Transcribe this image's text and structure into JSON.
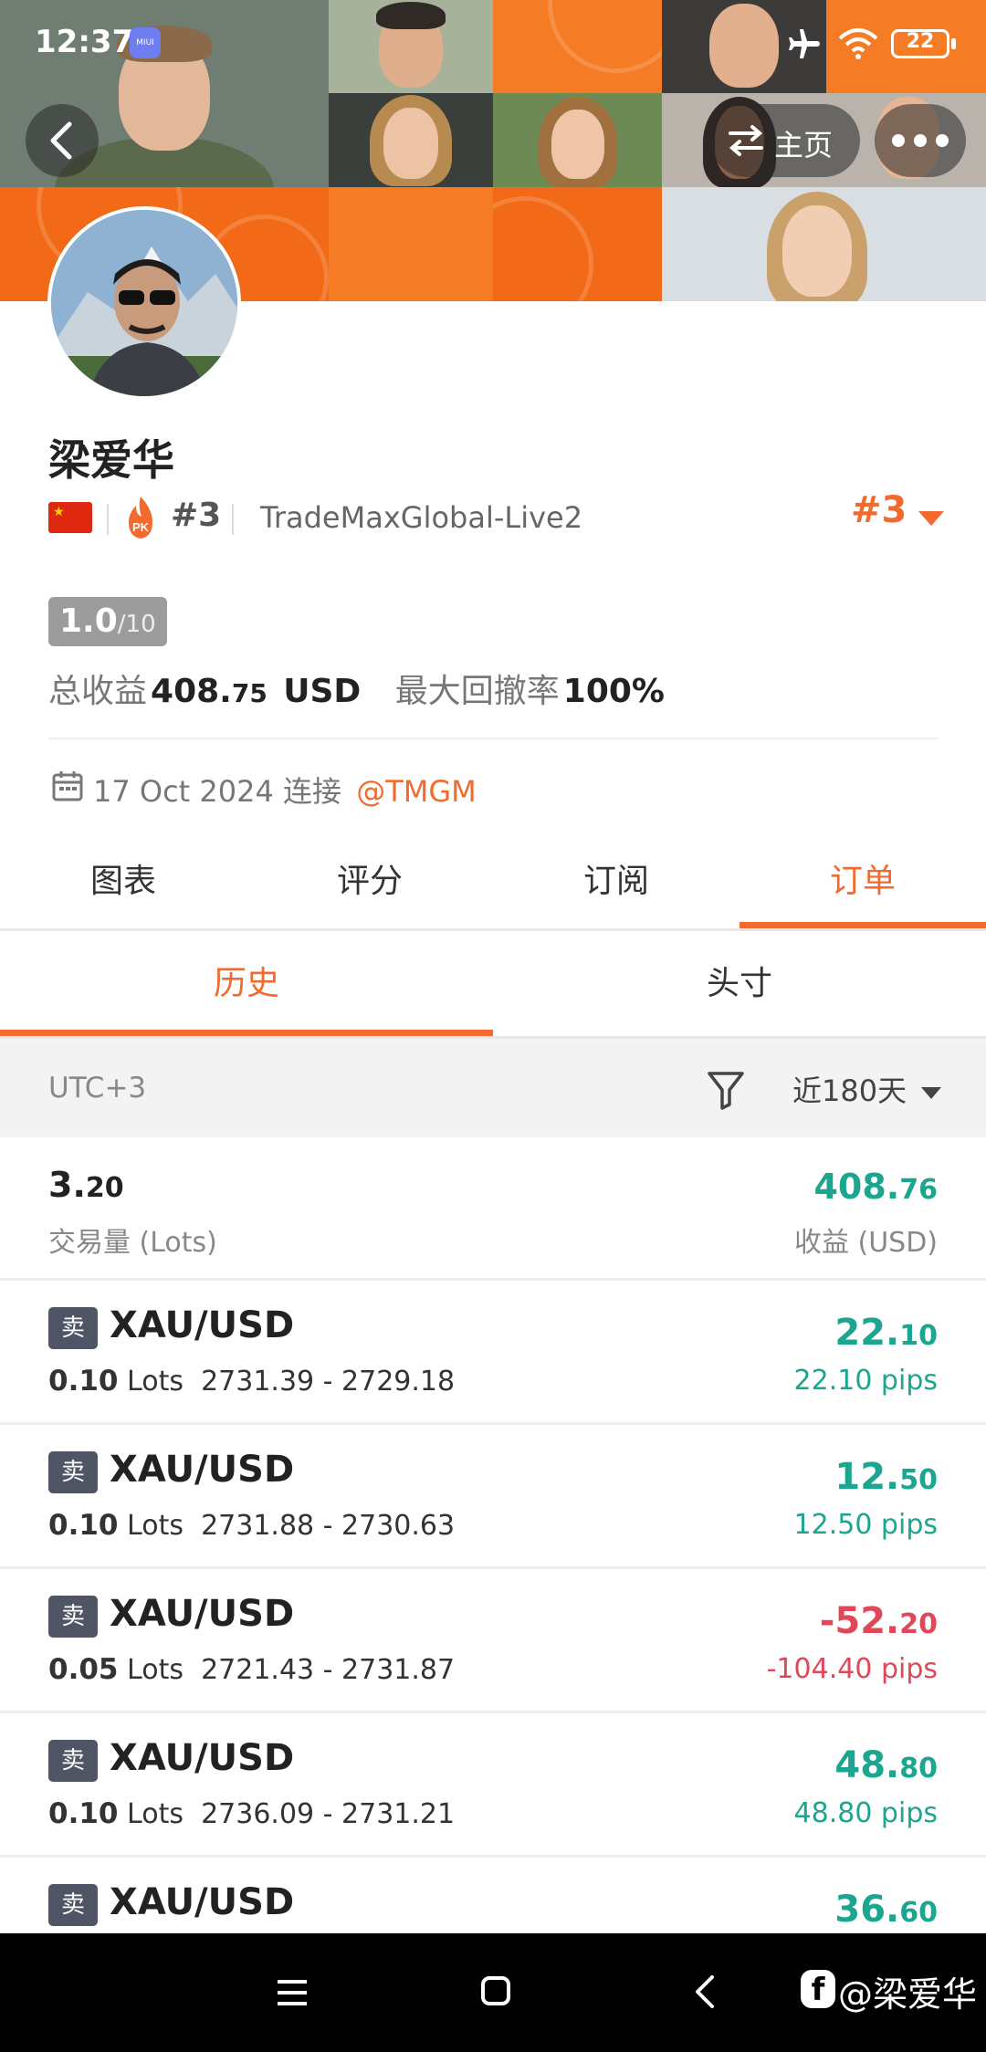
{
  "status_bar": {
    "time": "12:37",
    "miui": "MIUI",
    "battery": "22"
  },
  "header": {
    "home_label": "主页"
  },
  "profile": {
    "name": "梁爱华",
    "rank_badge": "#3",
    "server": "TradeMaxGlobal-Live2",
    "rank_right": "#3",
    "score_main": "1.0",
    "score_sub": "/10",
    "total_profit_label": "总收益",
    "total_profit_value": "408.",
    "total_profit_value_small": "75",
    "total_profit_unit": "USD",
    "max_drawdown_label": "最大回撤率",
    "max_drawdown_value": "100%",
    "connected_date": "17 Oct 2024",
    "connected_label": "连接",
    "broker": "@TMGM"
  },
  "main_tabs": [
    {
      "label": "图表",
      "active": false
    },
    {
      "label": "评分",
      "active": false
    },
    {
      "label": "订阅",
      "active": false
    },
    {
      "label": "订单",
      "active": true
    }
  ],
  "sub_tabs": [
    {
      "label": "历史",
      "active": true
    },
    {
      "label": "头寸",
      "active": false
    }
  ],
  "filter_bar": {
    "timezone": "UTC+3",
    "period": "近180天"
  },
  "summary": {
    "volume_main": "3.",
    "volume_small": "20",
    "volume_label": "交易量 (Lots)",
    "profit_main": "408.",
    "profit_small": "76",
    "profit_label": "收益 (USD)"
  },
  "orders": [
    {
      "side": "卖",
      "symbol": "XAU/USD",
      "lots": "0.10",
      "lots_unit": "Lots",
      "prices": "2731.39 - 2729.18",
      "profit_main": "22.",
      "profit_small": "10",
      "pips": "22.10 pips",
      "color": "green"
    },
    {
      "side": "卖",
      "symbol": "XAU/USD",
      "lots": "0.10",
      "lots_unit": "Lots",
      "prices": "2731.88 - 2730.63",
      "profit_main": "12.",
      "profit_small": "50",
      "pips": "12.50 pips",
      "color": "green"
    },
    {
      "side": "卖",
      "symbol": "XAU/USD",
      "lots": "0.05",
      "lots_unit": "Lots",
      "prices": "2721.43 - 2731.87",
      "profit_main": "-52.",
      "profit_small": "20",
      "pips": "-104.40 pips",
      "color": "red"
    },
    {
      "side": "卖",
      "symbol": "XAU/USD",
      "lots": "0.10",
      "lots_unit": "Lots",
      "prices": "2736.09 - 2731.21",
      "profit_main": "48.",
      "profit_small": "80",
      "pips": "48.80 pips",
      "color": "green"
    },
    {
      "side": "卖",
      "symbol": "XAU/USD",
      "lots": "",
      "lots_unit": "",
      "prices": "",
      "profit_main": "36.",
      "profit_small": "60",
      "pips": "",
      "color": "green"
    }
  ],
  "watermark": "@梁爱华",
  "colors": {
    "accent": "#f26a2e",
    "green": "#1ca58f",
    "red": "#e0485a",
    "badge": "#4f5565"
  }
}
